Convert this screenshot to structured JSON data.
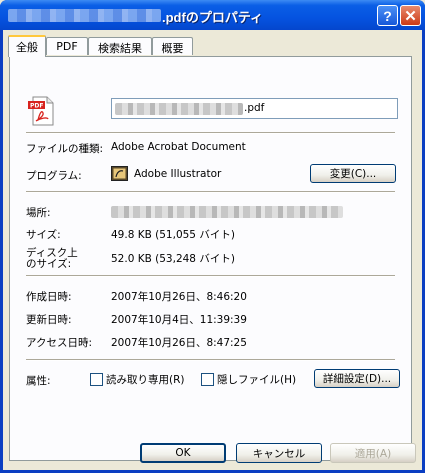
{
  "window": {
    "title_suffix": ".pdfのプロパティ",
    "help_label": "?",
    "close_label": "✕"
  },
  "tabs": [
    {
      "label": "全般"
    },
    {
      "label": "PDF"
    },
    {
      "label": "検索結果"
    },
    {
      "label": "概要"
    }
  ],
  "general": {
    "filename_suffix": ".pdf",
    "file_type_label": "ファイルの種類:",
    "file_type_value": "Adobe Acrobat Document",
    "program_label": "プログラム:",
    "program_value": "Adobe Illustrator",
    "change_button": "変更(C)...",
    "location_label": "場所:",
    "size_label": "サイズ:",
    "size_value": "49.8 KB (51,055 バイト)",
    "disk_size_label_1": "ディスク上",
    "disk_size_label_2": "のサイズ:",
    "disk_size_value": "52.0 KB (53,248 バイト)",
    "created_label": "作成日時:",
    "created_value": "2007年10月26日、8:46:20",
    "modified_label": "更新日時:",
    "modified_value": "2007年10月4日、11:39:39",
    "accessed_label": "アクセス日時:",
    "accessed_value": "2007年10月26日、8:47:25",
    "attributes_label": "属性:",
    "readonly_label": "読み取り専用(R)",
    "hidden_label": "隠しファイル(H)",
    "advanced_button": "詳細設定(D)..."
  },
  "footer": {
    "ok_button": "OK",
    "cancel_button": "キャンセル",
    "apply_button": "適用(A)"
  },
  "colors": {
    "titlebar": "#0553e0",
    "panel_bg": "#fcfcfe",
    "dialog_bg": "#ece9d8",
    "button_border": "#003c74",
    "active_tab_accent": "#ffc83c"
  },
  "icons": {
    "file_icon": "pdf-file-icon",
    "program_icon": "illustrator-icon"
  }
}
